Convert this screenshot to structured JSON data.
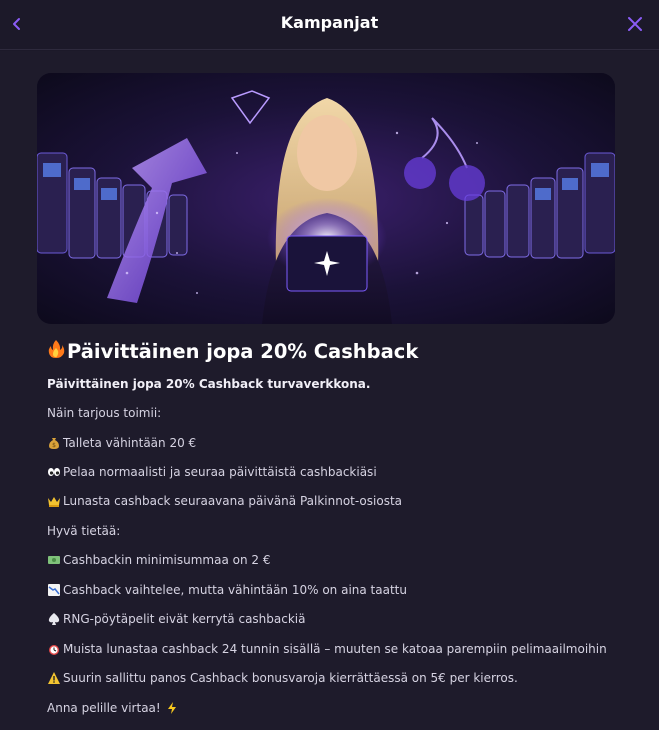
{
  "header": {
    "title": "Kampanjat",
    "back_icon": "chevron-left-icon",
    "close_icon": "close-icon",
    "accent": "#8b5cf6"
  },
  "banner": {
    "image": "promo-banner-woman-glowing-box-slot-machines"
  },
  "promo": {
    "title": "Päivittäinen jopa 20% Cashback",
    "title_icon": "fire-icon",
    "lines": [
      {
        "text": "Päivittäinen jopa 20% Cashback turvaverkkona.",
        "icon": ""
      },
      {
        "text": "Näin tarjous toimii:",
        "icon": ""
      },
      {
        "text": "Talleta vähintään 20 €",
        "icon": "money-bag-icon"
      },
      {
        "text": "Pelaa normaalisti ja seuraa päivittäistä cashbackiäsi",
        "icon": "eyes-icon"
      },
      {
        "text": "Lunasta cashback seuraavana päivänä Palkinnot-osiosta",
        "icon": "crown-icon"
      },
      {
        "text": "Hyvä tietää:",
        "icon": ""
      },
      {
        "text": "Cashbackin minimisummaa on 2 €",
        "icon": "banknote-icon"
      },
      {
        "text": "Cashback vaihtelee, mutta vähintään 10% on aina taattu",
        "icon": "chart-down-icon"
      },
      {
        "text": "RNG-pöytäpelit eivät kerrytä cashbackiä",
        "icon": "spade-icon"
      },
      {
        "text": "Muista lunastaa cashback 24 tunnin sisällä – muuten se katoaa parempiin pelimaailmoihin",
        "icon": "alarm-clock-icon"
      },
      {
        "text": "Suurin sallittu panos Cashback bonusvaroja kierrättäessä on 5€ per kierros.",
        "icon": "warning-icon"
      },
      {
        "text": "Anna pelille virtaa!",
        "icon": "lightning-icon"
      }
    ]
  }
}
